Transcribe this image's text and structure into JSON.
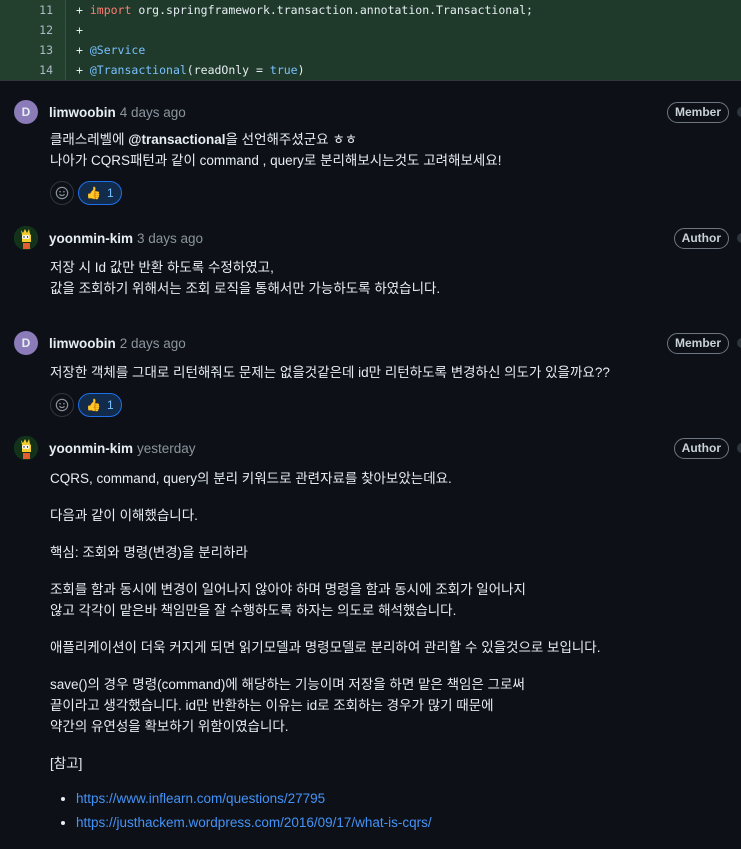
{
  "diff": {
    "lines": [
      {
        "num": "11",
        "prefix": "+ ",
        "kw": "import",
        "rest": " org.springframework.transaction.annotation.Transactional;"
      },
      {
        "num": "12",
        "prefix": "+",
        "kw": "",
        "rest": ""
      },
      {
        "num": "13",
        "prefix": "+ ",
        "ann": "@Service"
      },
      {
        "num": "14",
        "prefix": "+ ",
        "ann": "@Transactional",
        "args_pre": "(readOnly = ",
        "bool": "true",
        "args_post": ")"
      }
    ]
  },
  "comments": [
    {
      "avatar_letter": "D",
      "author": "limwoobin",
      "time": "4 days ago",
      "badge": "Member",
      "lines": [
        {
          "pre": "클래스레벨에 ",
          "bold": "@transactional",
          "post": "을 선언해주셨군요 ㅎㅎ"
        },
        {
          "pre": "나아가 CQRS패턴과 같이 command , query로 분리해보시는것도 고려해보세요!"
        }
      ],
      "reaction_emoji": "👍",
      "reaction_count": "1"
    },
    {
      "author": "yoonmin-kim",
      "time": "3 days ago",
      "badge": "Author",
      "lines": [
        "저장 시 Id 값만 반환 하도록 수정하였고,",
        "값을 조회하기 위해서는 조회 로직을 통해서만 가능하도록 하였습니다."
      ]
    },
    {
      "avatar_letter": "D",
      "author": "limwoobin",
      "time": "2 days ago",
      "badge": "Member",
      "lines": [
        "저장한 객체를 그대로 리턴해줘도 문제는 없을것같은데 id만 리턴하도록 변경하신 의도가 있을까요??"
      ],
      "reaction_emoji": "👍",
      "reaction_count": "1"
    },
    {
      "author": "yoonmin-kim",
      "time": "yesterday",
      "badge": "Author",
      "paragraphs": [
        [
          "CQRS, command, query의 분리 키워드로 관련자료를 찾아보았는데요."
        ],
        [
          "다음과 같이 이해했습니다."
        ],
        [
          "핵심: 조회와 명령(변경)을 분리하라"
        ],
        [
          "조회를 함과 동시에 변경이 일어나지 않아야 하며 명령을 함과 동시에 조회가 일어나지",
          "않고 각각이 맡은바 책임만을 잘 수행하도록 하자는 의도로 해석했습니다."
        ],
        [
          "애플리케이션이 더욱 커지게 되면 읽기모델과 명령모델로 분리하여 관리할 수 있을것으로 보입니다."
        ],
        [
          "save()의 경우 명령(command)에 해당하는 기능이며 저장을 하면 맡은 책임은 그로써",
          "끝이라고 생각했습니다. id만 반환하는 이유는 id로 조회하는 경우가 많기 때문에",
          "약간의 유연성을 확보하기 위함이였습니다."
        ],
        [
          "[참고]"
        ]
      ],
      "links": [
        "https://www.inflearn.com/questions/27795",
        "https://justhackem.wordpress.com/2016/09/17/what-is-cqrs/"
      ]
    }
  ]
}
